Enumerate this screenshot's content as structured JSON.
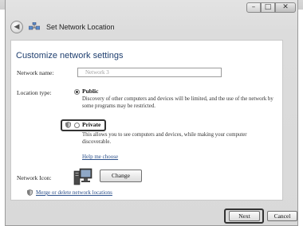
{
  "window": {
    "title": "Set Network Location",
    "controls": {
      "minimize": "–",
      "maximize": "□",
      "close": "✕"
    }
  },
  "main": {
    "heading": "Customize network settings",
    "network_name_label": "Network name:",
    "network_name_value": "Network 3",
    "location_type_label": "Location type:",
    "options": [
      {
        "label": "Public",
        "selected": true,
        "description": "Discovery of other computers and devices will be limited, and the use of the network by some programs may be restricted."
      },
      {
        "label": "Private",
        "selected": false,
        "description": "This allows you to see computers and devices, while making your computer discoverable."
      }
    ],
    "help_link": "Help me choose",
    "network_icon_label": "Network Icon:",
    "change_button": "Change",
    "merge_link": "Merge or delete network locations"
  },
  "footer": {
    "next_button": "Next",
    "cancel_button": "Cancel"
  },
  "colors": {
    "heading": "#1f3f6f",
    "link": "#2a4f8a",
    "highlight_border": "#333333"
  }
}
